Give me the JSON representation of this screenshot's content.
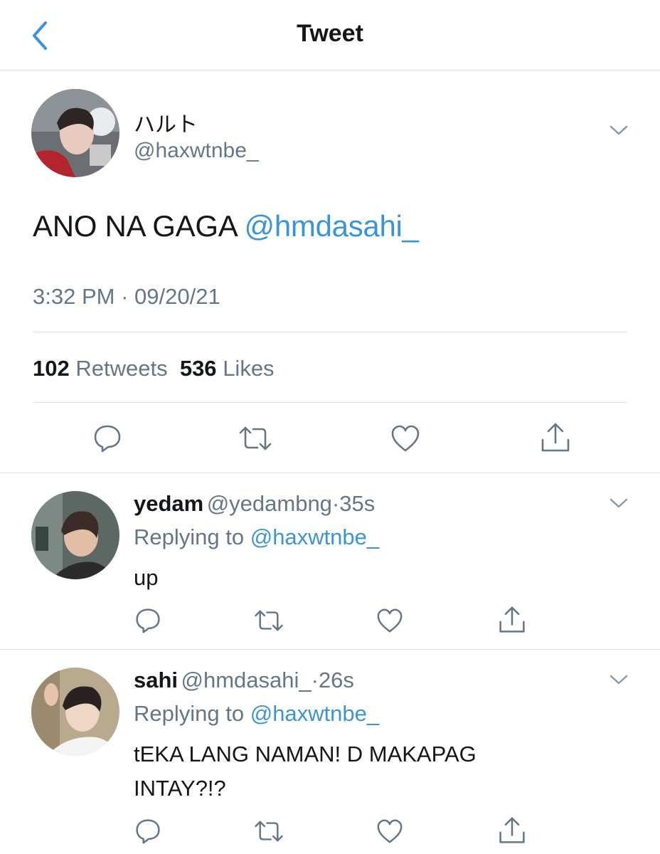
{
  "header": {
    "title": "Tweet",
    "back_icon": "chevron-left-icon",
    "accent_color": "#3b94d9"
  },
  "tweet": {
    "author_name": "ハルト",
    "author_handle": "@haxwtnbe_",
    "text": "ANO NA GAGA",
    "mention": "@hmdasahi_",
    "time": "3:32 PM",
    "date": "09/20/21",
    "separator": "·",
    "retweets_count": "102",
    "retweets_label": "Retweets",
    "likes_count": "536",
    "likes_label": "Likes",
    "actions": [
      "reply-icon",
      "retweet-icon",
      "like-icon",
      "share-icon"
    ]
  },
  "replies": [
    {
      "name": "yedam",
      "handle": "@yedambng",
      "separator": "·",
      "age": "35s",
      "replying_prefix": "Replying to",
      "replying_to": "@haxwtnbe_",
      "text_lines": [
        "up"
      ]
    },
    {
      "name": "sahi",
      "handle": "@hmdasahi_",
      "separator": "·",
      "age": "26s",
      "replying_prefix": "Replying to",
      "replying_to": "@haxwtnbe_",
      "text_lines": [
        "tEKA LANG NAMAN! D MAKAPAG",
        "INTAY?!?"
      ]
    }
  ]
}
